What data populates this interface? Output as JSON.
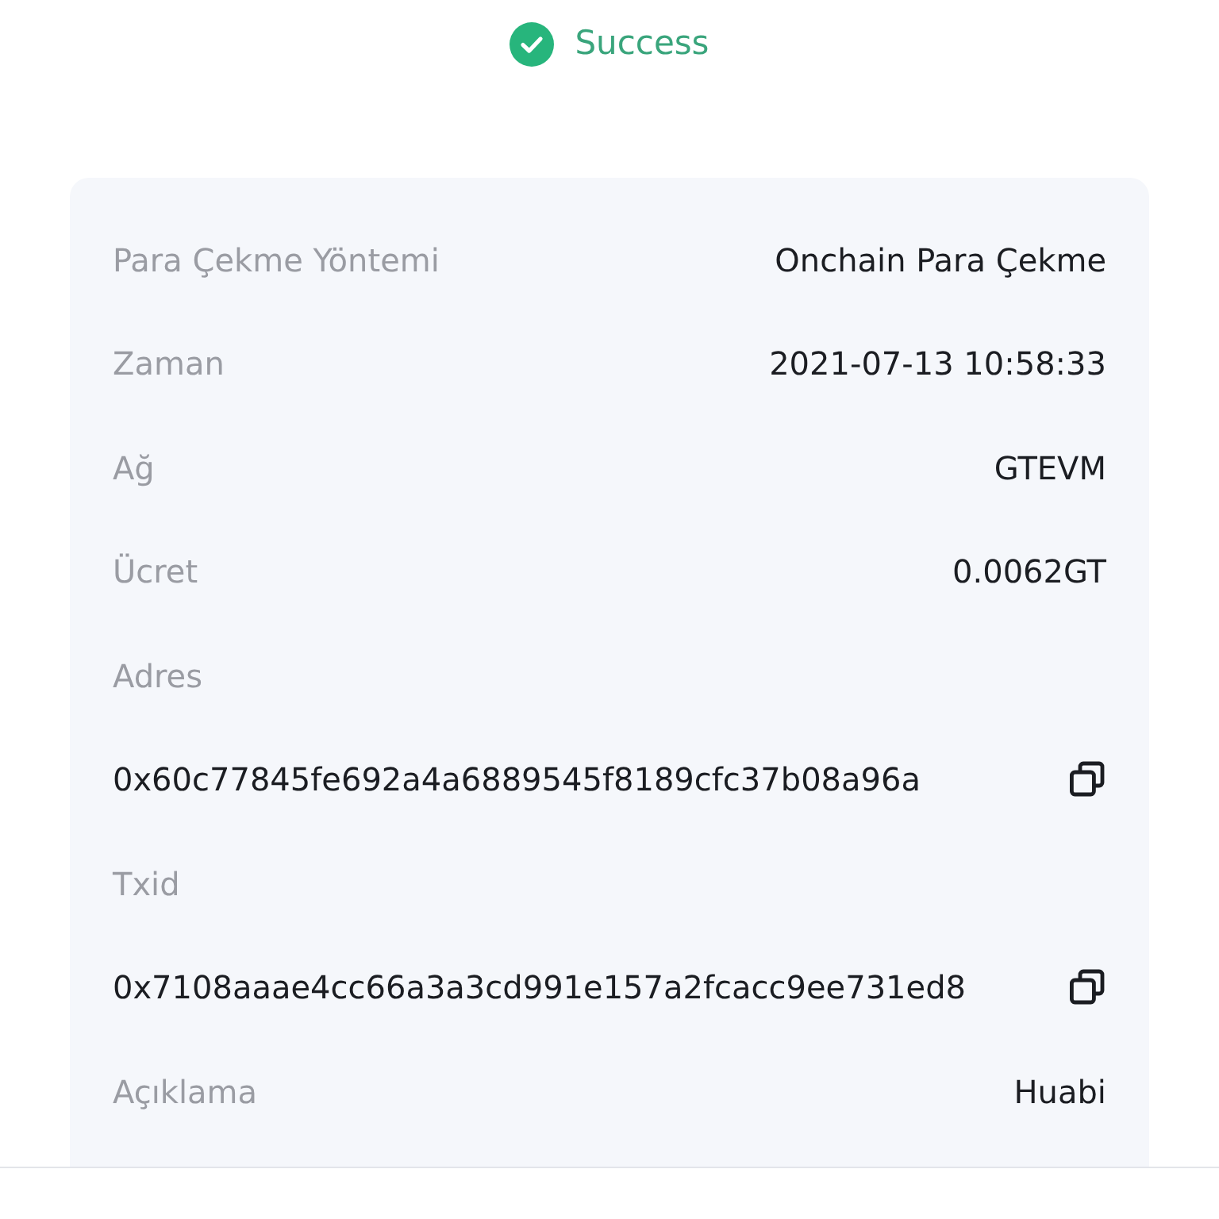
{
  "status": {
    "kind": "success",
    "text": "Success"
  },
  "details": [
    {
      "kind": "inline",
      "label": "Para Çekme Yöntemi",
      "value": "Onchain Para Çekme"
    },
    {
      "kind": "inline",
      "label": "Zaman",
      "value": "2021-07-13 10:58:33"
    },
    {
      "kind": "inline",
      "label": "Ağ",
      "value": "GTEVM"
    },
    {
      "kind": "inline",
      "label": "Ücret",
      "value": "0.0062GT"
    },
    {
      "kind": "copy",
      "label": "Adres",
      "value": "0x60c77845fe692a4a6889545f8189cfc37b08a96a"
    },
    {
      "kind": "copy",
      "label": "Txid",
      "value": "0x7108aaae4cc66a3a3cd991e157a2fcacc9ee731ed8"
    },
    {
      "kind": "inline",
      "label": "Açıklama",
      "value": "Huabi"
    }
  ]
}
